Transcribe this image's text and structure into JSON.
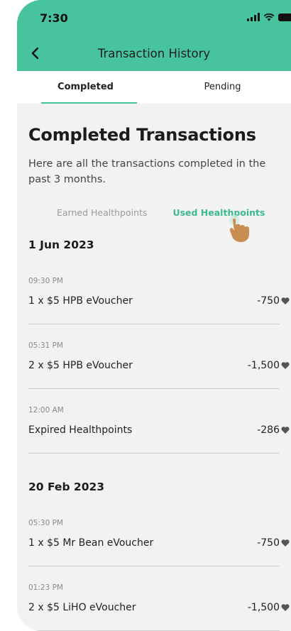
{
  "status_bar": {
    "time": "7:30"
  },
  "nav": {
    "title": "Transaction History"
  },
  "tabs": [
    {
      "label": "Completed",
      "active": true
    },
    {
      "label": "Pending",
      "active": false
    }
  ],
  "page": {
    "heading": "Completed Transactions",
    "description": "Here are all the transactions completed in the past 3 months."
  },
  "subtabs": {
    "earned": "Earned Healthpoints",
    "used": "Used Healthpoints"
  },
  "groups": [
    {
      "date": "1 Jun 2023",
      "items": [
        {
          "time": "09:30 PM",
          "name": "1 x $5 HPB eVoucher",
          "points": "-750"
        },
        {
          "time": "05:31 PM",
          "name": "2 x $5 HPB eVoucher",
          "points": "-1,500"
        },
        {
          "time": "12:00 AM",
          "name": "Expired Healthpoints",
          "points": "-286"
        }
      ]
    },
    {
      "date": "20 Feb 2023",
      "items": [
        {
          "time": "05:30 PM",
          "name": "1 x $5 Mr Bean eVoucher",
          "points": "-750"
        },
        {
          "time": "01:23 PM",
          "name": "2 x $5 LiHO eVoucher",
          "points": "-1,500"
        }
      ]
    }
  ],
  "colors": {
    "brand_green": "#47c49e",
    "active_subtab": "#3cba90",
    "background": "#f2f2f0"
  }
}
